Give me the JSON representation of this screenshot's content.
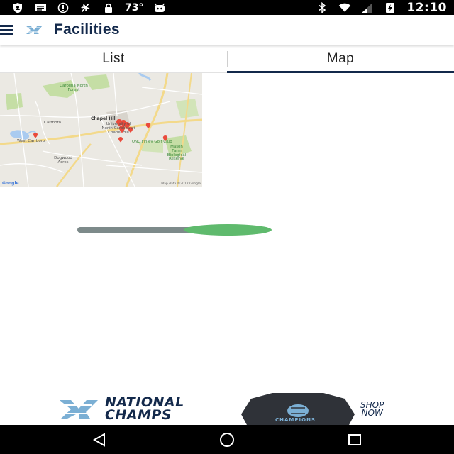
{
  "status_bar": {
    "temperature": "73°",
    "time": "12:10",
    "icons_left": [
      "shield-icon",
      "mail-icon",
      "info-icon",
      "fan-icon",
      "lock-icon",
      "android-icon"
    ],
    "icons_right": [
      "bluetooth-icon",
      "wifi-icon",
      "signal-icon",
      "battery-charging-icon"
    ]
  },
  "app_bar": {
    "title": "Facilities",
    "logo": "unc-logo",
    "accent_color": "#13294b",
    "logo_color": "#7bafd4"
  },
  "tabs": [
    {
      "label": "List",
      "active": false
    },
    {
      "label": "Map",
      "active": true
    }
  ],
  "map": {
    "labels": {
      "chapel_hill": "Chapel Hill",
      "unc": "University of North Carolina at Chapel Hill",
      "west_carrboro": "West Carrboro",
      "carrboro": "Carrboro",
      "finley": "UNC Finley Golf Club",
      "mason_farm": "Mason Farm Biological Reserve",
      "dogwood": "Dogwood Acres",
      "carolina_north": "Carolina North Forest"
    },
    "google": "Google",
    "attribution": "Map data ©2017 Google"
  },
  "loader": {
    "progress": 0.55,
    "track_color": "#7d8a8a",
    "fill_color": "#5fba6d"
  },
  "ad": {
    "headline_line1": "NATIONAL",
    "headline_line2": "CHAMPS",
    "shirt_text": "CHAMPIONS",
    "cta_line1": "SHOP",
    "cta_line2": "NOW"
  },
  "nav_bar": {
    "back": "back-icon",
    "home": "home-icon",
    "recents": "recents-icon"
  }
}
